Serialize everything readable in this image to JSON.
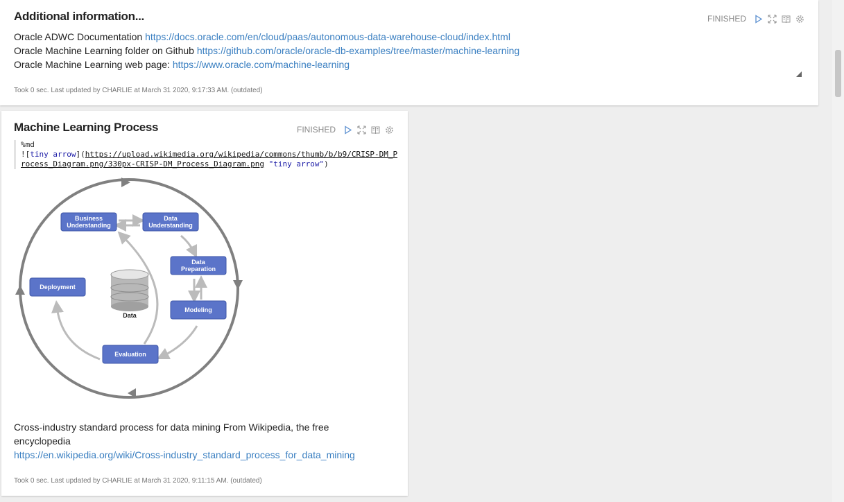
{
  "info_paragraph": {
    "title": "Additional information...",
    "status": "FINISHED",
    "lines": [
      {
        "label": "Oracle ADWC Documentation ",
        "link": "https://docs.oracle.com/en/cloud/paas/autonomous-data-warehouse-cloud/index.html"
      },
      {
        "label": "Oracle Machine Learning folder on Github ",
        "link": "https://github.com/oracle/oracle-db-examples/tree/master/machine-learning"
      },
      {
        "label": "Oracle Machine Learning web page: ",
        "link": "https://www.oracle.com/machine-learning"
      }
    ],
    "footer": "Took 0 sec. Last updated by CHARLIE at March 31 2020, 9:17:33 AM. (outdated)"
  },
  "ml_paragraph": {
    "title": "Machine Learning Process",
    "status": "FINISHED",
    "code": {
      "line1": "%md",
      "prefix": "![",
      "alt": "tiny arrow",
      "mid": "](",
      "url": "https://upload.wikimedia.org/wikipedia/commons/thumb/b/b9/CRISP-DM_Process_Diagram.png/330px-CRISP-DM_Process_Diagram.png",
      "space": " ",
      "title_str": "\"tiny arrow\"",
      "suffix": ")"
    },
    "diagram": {
      "nodes": {
        "business_1": "Business",
        "business_2": "Understanding",
        "data_und_1": "Data",
        "data_und_2": "Understanding",
        "data_prep_1": "Data",
        "data_prep_2": "Preparation",
        "modeling": "Modeling",
        "evaluation": "Evaluation",
        "deployment": "Deployment",
        "data": "Data"
      },
      "node_color": "#5b74c9"
    },
    "caption_text": "Cross-industry standard process for data mining From Wikipedia, the free encyclopedia",
    "caption_link": "https://en.wikipedia.org/wiki/Cross-industry_standard_process_for_data_mining",
    "footer": "Took 0 sec. Last updated by CHARLIE at March 31 2020, 9:11:15 AM. (outdated)"
  },
  "colors": {
    "link": "#3a7fc1",
    "control_icon": "#7a9cc6",
    "page_bg": "#eeeeee"
  }
}
